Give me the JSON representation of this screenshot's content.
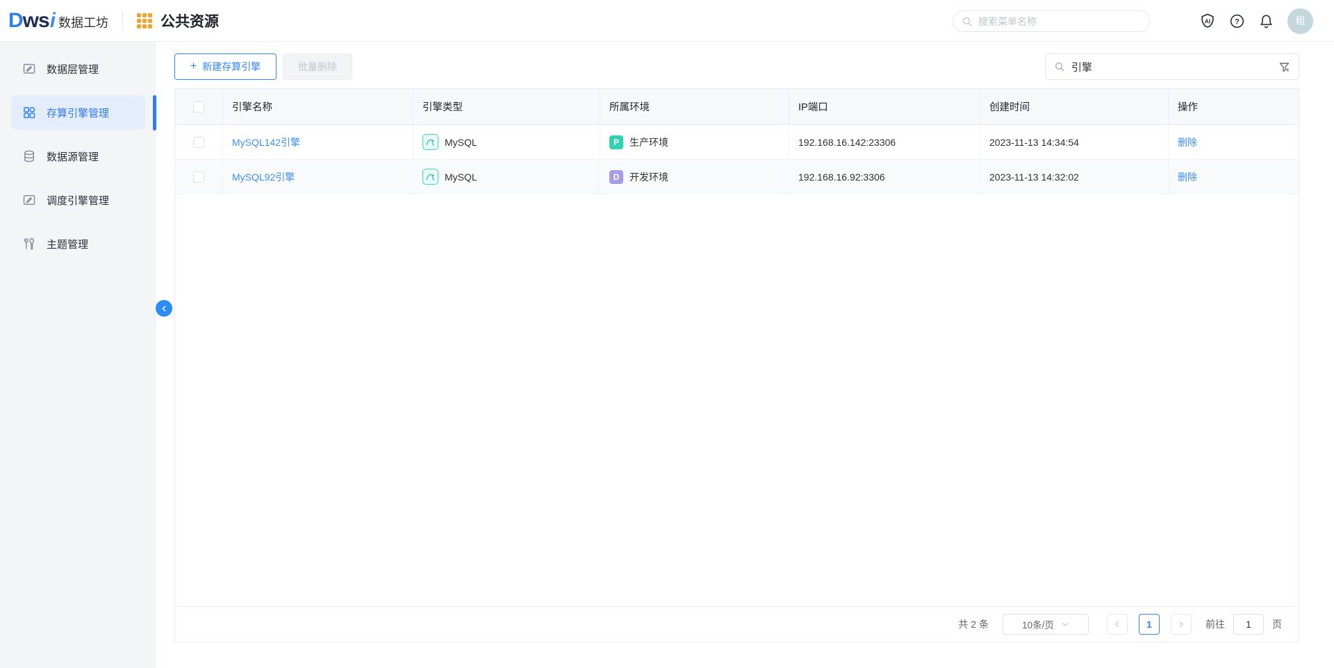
{
  "topbar": {
    "logo": {
      "d": "D",
      "ws": "ws",
      "i": "i",
      "name": "数据工坊"
    },
    "app_title": "公共资源",
    "search_placeholder": "搜索菜单名称",
    "avatar_text": "租"
  },
  "sidebar": {
    "items": [
      {
        "label": "数据层管理",
        "icon": "edit-square-icon",
        "active": false
      },
      {
        "label": "存算引擎管理",
        "icon": "grid-icon",
        "active": true
      },
      {
        "label": "数据源管理",
        "icon": "database-icon",
        "active": false
      },
      {
        "label": "调度引擎管理",
        "icon": "edit-square-icon",
        "active": false
      },
      {
        "label": "主题管理",
        "icon": "tools-icon",
        "active": false
      }
    ]
  },
  "toolbar": {
    "plus": "+",
    "create_label": "新建存算引擎",
    "batch_delete_label": "批量删除",
    "search_value": "引擎"
  },
  "table": {
    "columns": [
      "引擎名称",
      "引擎类型",
      "所属环境",
      "IP端口",
      "创建时间",
      "操作"
    ],
    "rows": [
      {
        "name": "MySQL142引擎",
        "type": "MySQL",
        "env_letter": "P",
        "env": "生产环境",
        "ip": "192.168.16.142:23306",
        "created": "2023-11-13 14:34:54",
        "action": "删除"
      },
      {
        "name": "MySQL92引擎",
        "type": "MySQL",
        "env_letter": "D",
        "env": "开发环境",
        "ip": "192.168.16.92:3306",
        "created": "2023-11-13 14:32:02",
        "action": "删除"
      }
    ]
  },
  "pagination": {
    "total_text": "共 2 条",
    "page_size": "10条/页",
    "current_page": "1",
    "goto_label": "前往",
    "goto_value": "1",
    "page_unit": "页"
  },
  "colors": {
    "accent_blue": "#3484fc",
    "link_blue": "#3e8ff2",
    "active_item_bg": "#e3edfc",
    "prod_badge": "#2fd3b2",
    "dev_badge": "#a79cec",
    "mysql_teal": "#3fd6b8",
    "header_bg": "#f7f8fa",
    "app_icon_orange": "#f2a52a"
  }
}
